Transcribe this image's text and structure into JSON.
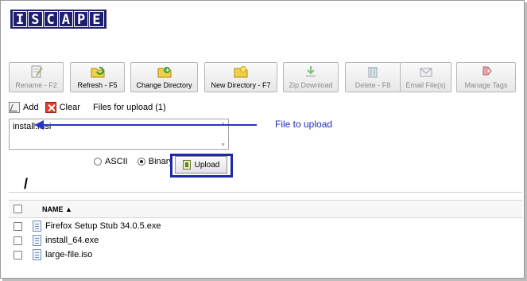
{
  "logo": {
    "letters": [
      "I",
      "S",
      "C",
      "A",
      "P",
      "E"
    ]
  },
  "toolbar": {
    "buttons": [
      {
        "label": "Rename - F2",
        "icon": "rename-icon",
        "disabled": true
      },
      {
        "label": "Refresh - F5",
        "icon": "refresh-folder-icon",
        "disabled": false
      },
      {
        "label": "Change Directory",
        "icon": "change-directory-icon",
        "disabled": false
      },
      {
        "label": "New Directory - F7",
        "icon": "new-directory-icon",
        "disabled": false
      },
      {
        "label": "Zip Download",
        "icon": "zip-download-icon",
        "disabled": true
      },
      {
        "label": "Delete - F8",
        "icon": "trash-icon",
        "disabled": true
      },
      {
        "label": "Email File(s)",
        "icon": "email-icon",
        "disabled": true
      },
      {
        "label": "Manage Tags",
        "icon": "tag-icon",
        "disabled": true
      }
    ]
  },
  "upload": {
    "add_label": "Add",
    "clear_label": "Clear",
    "files_for_upload": "Files for upload (1)",
    "queued_file": "install.msi",
    "annotation": "File to upload",
    "mode_ascii": "ASCII",
    "mode_binary": "Binary",
    "selected_mode": "Binary",
    "upload_button": "Upload"
  },
  "path": "/",
  "table": {
    "name_header": "NAME ▲",
    "rows": [
      {
        "name": "Firefox Setup Stub 34.0.5.exe"
      },
      {
        "name": "install_64.exe"
      },
      {
        "name": "large-file.iso"
      }
    ]
  },
  "colors": {
    "annotation": "#1f2bbf",
    "highlight": "#1e28a8",
    "logo": "#1f1f6e"
  }
}
